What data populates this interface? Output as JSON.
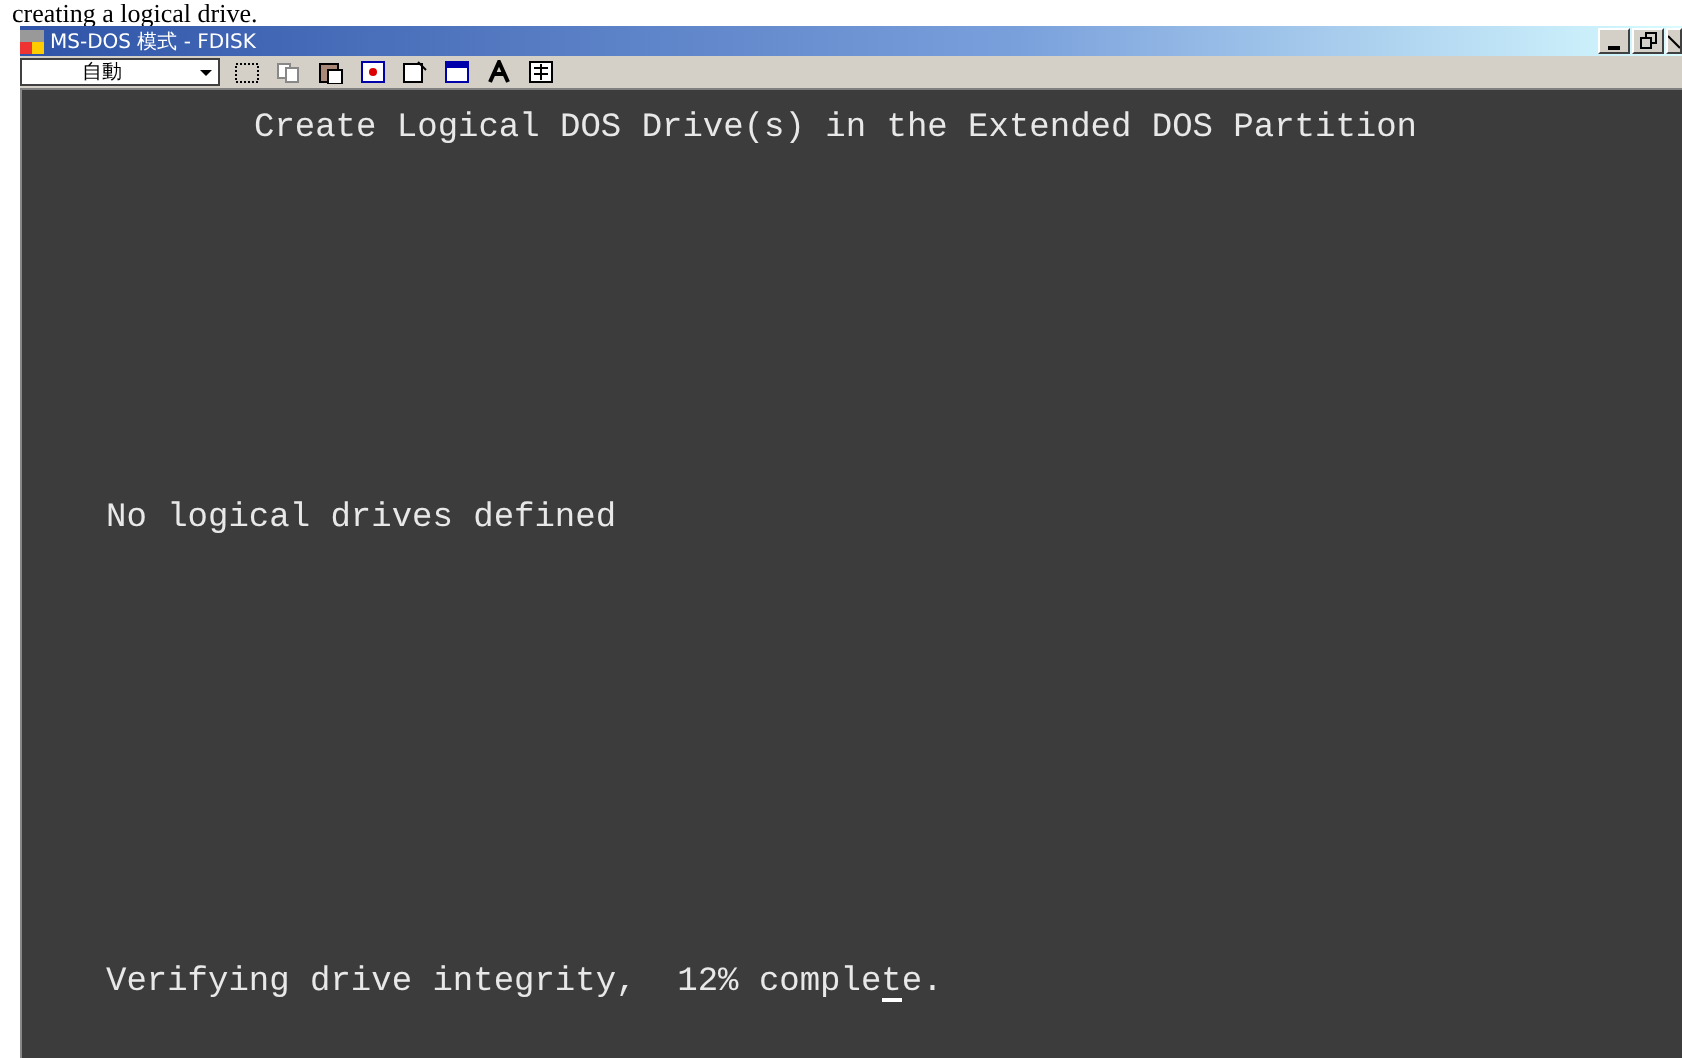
{
  "caption": "creating a logical drive.",
  "window": {
    "title": "MS-DOS 模式 - FDISK"
  },
  "toolbar": {
    "font_select": "自動"
  },
  "screen": {
    "heading": "Create Logical DOS Drive(s) in the Extended DOS Partition",
    "message": "No logical drives defined",
    "status": "Verifying drive integrity,  12% complete."
  }
}
